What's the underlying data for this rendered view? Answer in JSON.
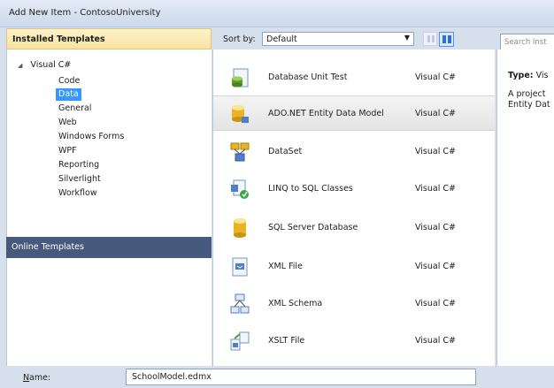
{
  "window": {
    "title": "Add New Item - ContosoUniversity"
  },
  "left_pane": {
    "installed_header": "Installed Templates",
    "tree_root": "Visual C#",
    "tree_items": [
      "Code",
      "Data",
      "General",
      "Web",
      "Windows Forms",
      "WPF",
      "Reporting",
      "Silverlight",
      "Workflow"
    ],
    "selected_item": "Data",
    "online_header": "Online Templates"
  },
  "toolbar": {
    "sort_label": "Sort by:",
    "sort_value": "Default"
  },
  "templates": [
    {
      "name": "Database Unit Test",
      "language": "Visual C#",
      "icon": "database-unit-test-icon"
    },
    {
      "name": "ADO.NET Entity Data Model",
      "language": "Visual C#",
      "icon": "entity-data-model-icon",
      "selected": true
    },
    {
      "name": "DataSet",
      "language": "Visual C#",
      "icon": "dataset-icon"
    },
    {
      "name": "LINQ to SQL Classes",
      "language": "Visual C#",
      "icon": "linq-to-sql-icon"
    },
    {
      "name": "SQL Server Database",
      "language": "Visual C#",
      "icon": "sql-database-icon"
    },
    {
      "name": "XML File",
      "language": "Visual C#",
      "icon": "xml-file-icon"
    },
    {
      "name": "XML Schema",
      "language": "Visual C#",
      "icon": "xml-schema-icon"
    },
    {
      "name": "XSLT File",
      "language": "Visual C#",
      "icon": "xslt-file-icon"
    }
  ],
  "details": {
    "search_placeholder": "Search Inst",
    "type_label": "Type:",
    "type_value": "Vis",
    "description_line1": "A project",
    "description_line2": "Entity Dat"
  },
  "bottom": {
    "name_label_first": "N",
    "name_label_rest": "ame:",
    "name_value": "SchoolModel.edmx"
  }
}
